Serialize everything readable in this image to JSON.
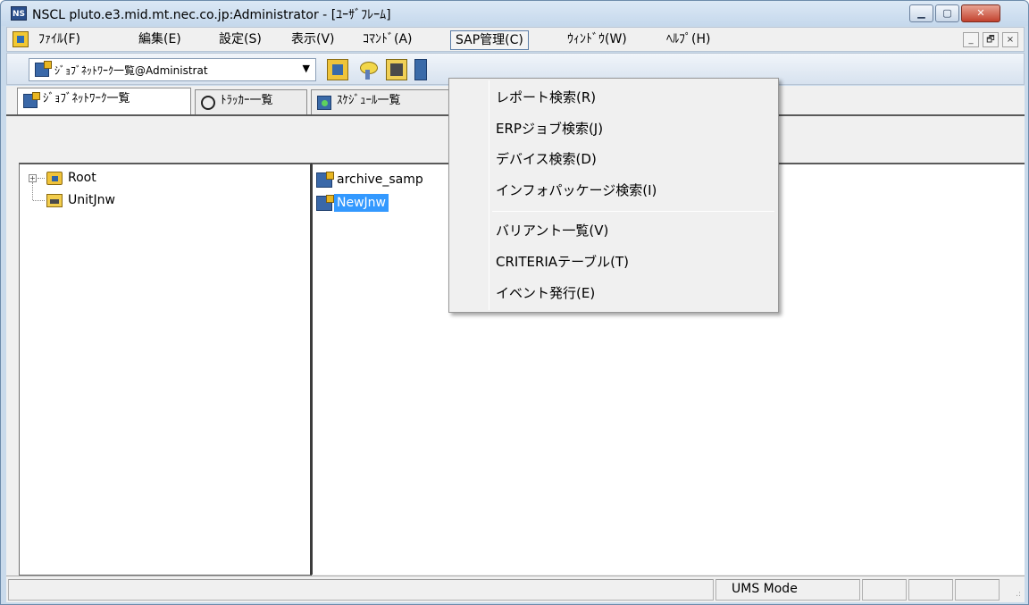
{
  "window": {
    "app_icon": "NS",
    "title": "NSCL pluto.e3.mid.mt.nec.co.jp:Administrator - [ﾕｰｻﾞﾌﾚｰﾑ]",
    "controls": [
      "minimize-icon",
      "maximize-icon",
      "close-icon"
    ]
  },
  "menubar": {
    "items": [
      {
        "label": "ﾌｧｲﾙ(F)"
      },
      {
        "label": "編集(E)"
      },
      {
        "label": "設定(S)"
      },
      {
        "label": "表示(V)"
      },
      {
        "label": "ｺﾏﾝﾄﾞ(A)"
      },
      {
        "label": "SAP管理(C)",
        "active": true
      },
      {
        "label": "ｳｨﾝﾄﾞｳ(W)"
      },
      {
        "label": "ﾍﾙﾌﾟ(H)"
      }
    ],
    "mdi_controls": {
      "minimize": "_",
      "restore": "🗗",
      "close": "×"
    }
  },
  "toolbar": {
    "combo_value": "ｼﾞｮﾌﾞﾈｯﾄﾜｰｸ一覧@Administrat",
    "combo_arrow": "▼"
  },
  "tabs": [
    {
      "label": "ｼﾞｮﾌﾞﾈｯﾄﾜｰｸ一覧",
      "icon": "jobnetwork-icon"
    },
    {
      "label": "ﾄﾗｯｶｰ一覧",
      "icon": "tracker-icon"
    },
    {
      "label": "ｽｹｼﾞｭｰﾙ一覧",
      "icon": "schedule-icon"
    }
  ],
  "tree": {
    "expander": "+",
    "nodes": [
      {
        "label": "Root",
        "icon": "folder-icon"
      },
      {
        "label": "UnitJnw",
        "icon": "unit-icon"
      }
    ]
  },
  "list": {
    "items": [
      {
        "label": "archive_samp",
        "selected": false
      },
      {
        "label": "NewJnw",
        "selected": true
      }
    ]
  },
  "sap_menu": {
    "items": [
      "レポート検索(R)",
      "ERPジョブ検索(J)",
      "デバイス検索(D)",
      "インフォパッケージ検索(I)",
      "バリアント一覧(V)",
      "CRITERIAテーブル(T)",
      "イベント発行(E)"
    ]
  },
  "statusbar": {
    "mode": "UMS Mode",
    "grip": ".:"
  }
}
